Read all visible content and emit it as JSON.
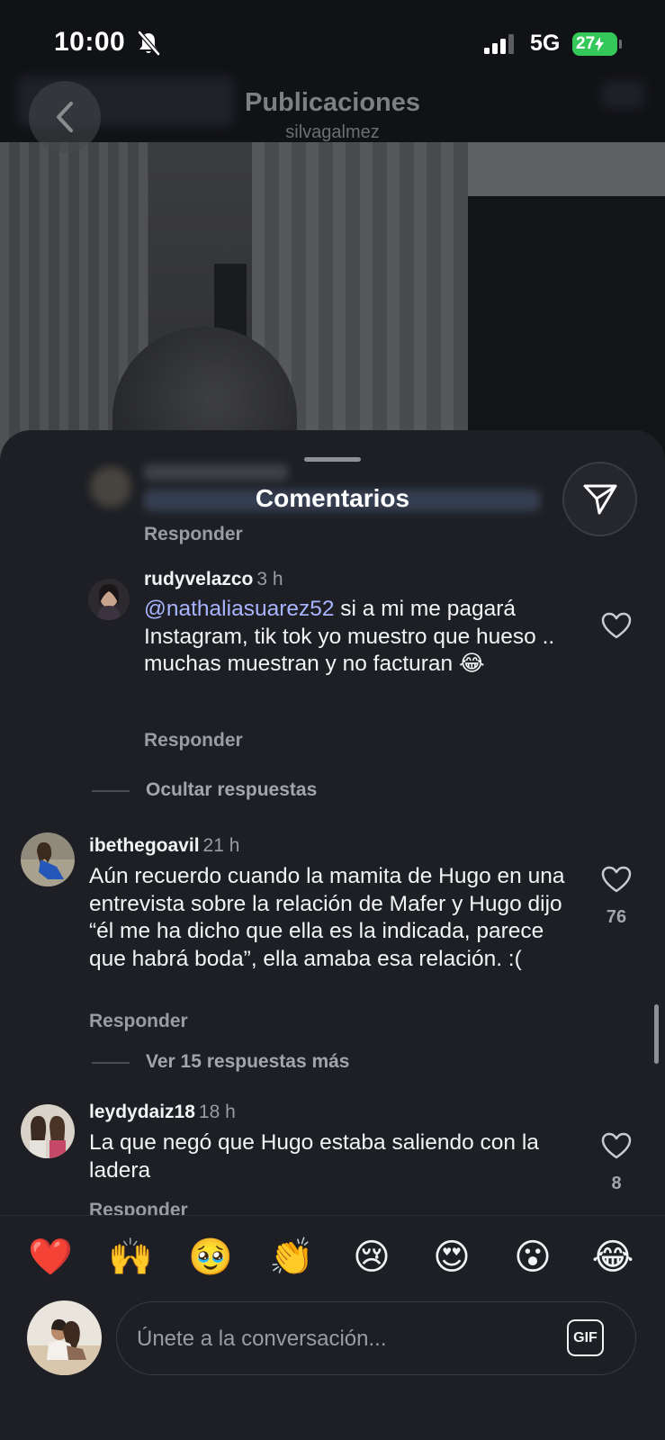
{
  "status_bar": {
    "time": "10:00",
    "network": "5G",
    "battery": "27"
  },
  "header": {
    "title": "Publicaciones",
    "username": "silvagalmez"
  },
  "comments_sheet": {
    "title": "Comentarios",
    "items": [
      {
        "respond_label": "Responder"
      },
      {
        "username": "rudyvelazco",
        "time": "3 h",
        "mention": "@nathaliasuarez52",
        "text": " si a mi me pagará Instagram,  tik tok yo muestro que hueso .. muchas muestran y no facturan 😂",
        "respond_label": "Responder"
      },
      {
        "username": "ibethegoavil",
        "time": "21 h",
        "text": "Aún recuerdo cuando la mamita de Hugo en una entrevista sobre la relación de Mafer y Hugo dijo “él me ha dicho que ella es la indicada, parece que habrá boda”, ella amaba esa relación. :(",
        "likes": "76",
        "respond_label": "Responder"
      },
      {
        "username": "leydydaiz18",
        "time": "18 h",
        "text": "La que negó que Hugo estaba saliendo con la ladera",
        "likes": "8",
        "respond_label": "Responder"
      }
    ],
    "hide_replies_label": "Ocultar respuestas",
    "more_replies_label": "Ver 15 respuestas más"
  },
  "quick_reactions": [
    "❤️",
    "🙌",
    "🥹",
    "👏",
    "😢",
    "😍",
    "😮",
    "😂"
  ],
  "composer": {
    "placeholder": "Únete a la conversación...",
    "gif_label": "GIF"
  },
  "icons": {
    "back": "chevron-left-icon",
    "share": "paper-plane-icon",
    "like": "heart-outline-icon",
    "muted": "bell-slash-icon"
  }
}
